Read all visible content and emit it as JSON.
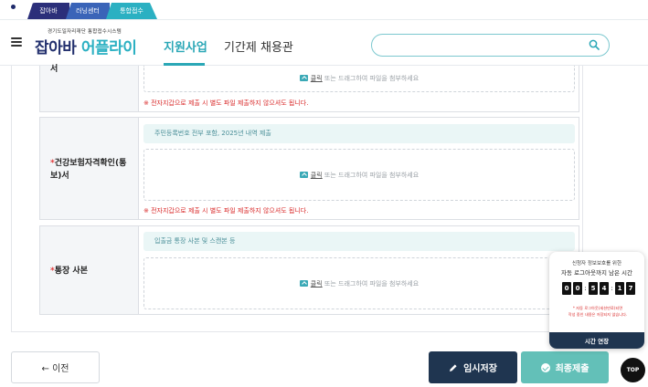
{
  "top_tabs": [
    "잡아바",
    "러닝센터",
    "통합접수"
  ],
  "header": {
    "logo_sub": "경기도일자리재단 통합접수시스템",
    "logo_part1": "잡아바 ",
    "logo_part2": "어플라이",
    "nav": [
      "지원사업",
      "기간제 채용관"
    ],
    "search_placeholder": ""
  },
  "form": {
    "row1": {
      "label": "서",
      "drop_link": "클릭",
      "drop_rest": " 또는 드래그하여 파일을 첨부하세요",
      "warning": "※ 전자지갑으로 제출 시 별도 파일 제출하지 않으셔도 됩니다."
    },
    "row2": {
      "required": "*",
      "label_line1": "건강보험자격확인(통",
      "label_line2": "보)서",
      "hint": "주민등록번호 전부 포함, 2025년 내역 제출",
      "drop_link": "클릭",
      "drop_rest": " 또는 드래그하여 파일을 첨부하세요",
      "warning": "※ 전자지갑으로 제출 시 별도 파일 제출하지 않으셔도 됩니다."
    },
    "row3": {
      "required": "*",
      "label": "통장 사본",
      "hint": "입출금 통장 사본 및 스캔본 등",
      "drop_link": "클릭",
      "drop_rest": " 또는 드래그하여 파일을 첨부하세요"
    }
  },
  "buttons": {
    "prev": "← 이전",
    "save": "임시저장",
    "submit": "최종제출",
    "top": "TOP"
  },
  "session": {
    "line1": "신청자 정보보호를 위한",
    "line2": "자동 로그아웃까지 남은 시간",
    "digits": [
      "0",
      "0",
      "5",
      "4",
      "1",
      "7"
    ],
    "note_line1": "* 자동 로그아웃(세션만료)되면",
    "note_line2": "작성 중인 내용은 저장되지 않습니다.",
    "extend": "시간 연장"
  },
  "colors": {
    "navy": "#1f3550",
    "teal": "#2aa7b6",
    "mint": "#63c0b8",
    "warning_red": "#d92a2a"
  }
}
